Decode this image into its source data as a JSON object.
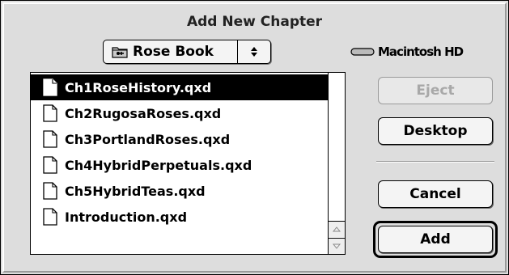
{
  "dialog": {
    "title": "Add New Chapter"
  },
  "folder_popup": {
    "selected": "Rose Book",
    "icon": "folder-icon"
  },
  "volume": {
    "label": "Macintosh HD",
    "icon": "hard-disk-icon"
  },
  "file_list": {
    "selected_index": 0,
    "items": [
      {
        "name": "Ch1RoseHistory.qxd",
        "icon": "document-icon"
      },
      {
        "name": "Ch2RugosaRoses.qxd",
        "icon": "document-icon"
      },
      {
        "name": "Ch3PortlandRoses.qxd",
        "icon": "document-icon"
      },
      {
        "name": "Ch4HybridPerpetuals.qxd",
        "icon": "document-icon"
      },
      {
        "name": "Ch5HybridTeas.qxd",
        "icon": "document-icon"
      },
      {
        "name": "Introduction.qxd",
        "icon": "document-icon"
      }
    ]
  },
  "buttons": {
    "eject": "Eject",
    "desktop": "Desktop",
    "cancel": "Cancel",
    "add": "Add"
  },
  "colors": {
    "dialog_bg": "#dddddd",
    "selection_bg": "#000000",
    "selection_fg": "#ffffff",
    "disabled_text": "#a8a8a8"
  }
}
